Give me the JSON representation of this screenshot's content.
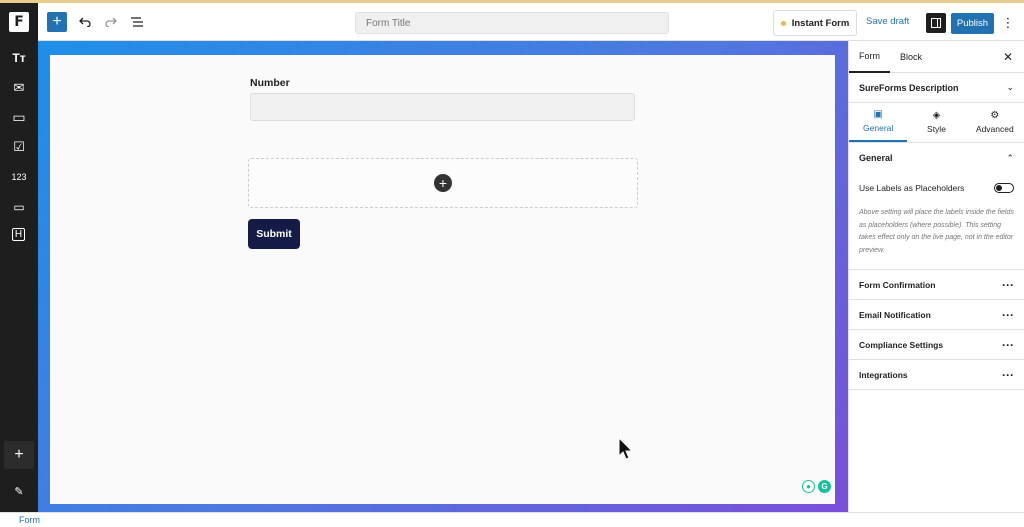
{
  "topbar": {
    "form_title_placeholder": "Form Title",
    "instant_form_label": "Instant Form",
    "save_draft_label": "Save draft",
    "publish_label": "Publish"
  },
  "leftbar": {
    "items": [
      {
        "icon": "text-icon",
        "glyph": "Tт"
      },
      {
        "icon": "email-icon",
        "glyph": "✉"
      },
      {
        "icon": "textarea-icon",
        "glyph": "▭"
      },
      {
        "icon": "checkbox-icon",
        "glyph": "☑"
      },
      {
        "icon": "number-icon",
        "glyph": "123"
      },
      {
        "icon": "dropdown-icon",
        "glyph": "▭"
      },
      {
        "icon": "heading-icon",
        "glyph": "H"
      }
    ]
  },
  "canvas": {
    "field_label": "Number",
    "submit_label": "Submit"
  },
  "panel": {
    "tabs": [
      "Form",
      "Block"
    ],
    "description_title": "SureForms Description",
    "subtabs": [
      "General",
      "Style",
      "Advanced"
    ],
    "general_title": "General",
    "toggle_label": "Use Labels as Placeholders",
    "toggle_value": false,
    "help_text": "Above setting will place the labels inside the fields as placeholders (where possible). This setting takes effect only on the live page, not in the editor preview.",
    "sections": [
      "Form Confirmation",
      "Email Notification",
      "Compliance Settings",
      "Integrations"
    ]
  },
  "breadcrumb": "Form",
  "colors": {
    "accent": "#2271b1",
    "submit": "#141b47",
    "dark": "#1e1e1e"
  }
}
